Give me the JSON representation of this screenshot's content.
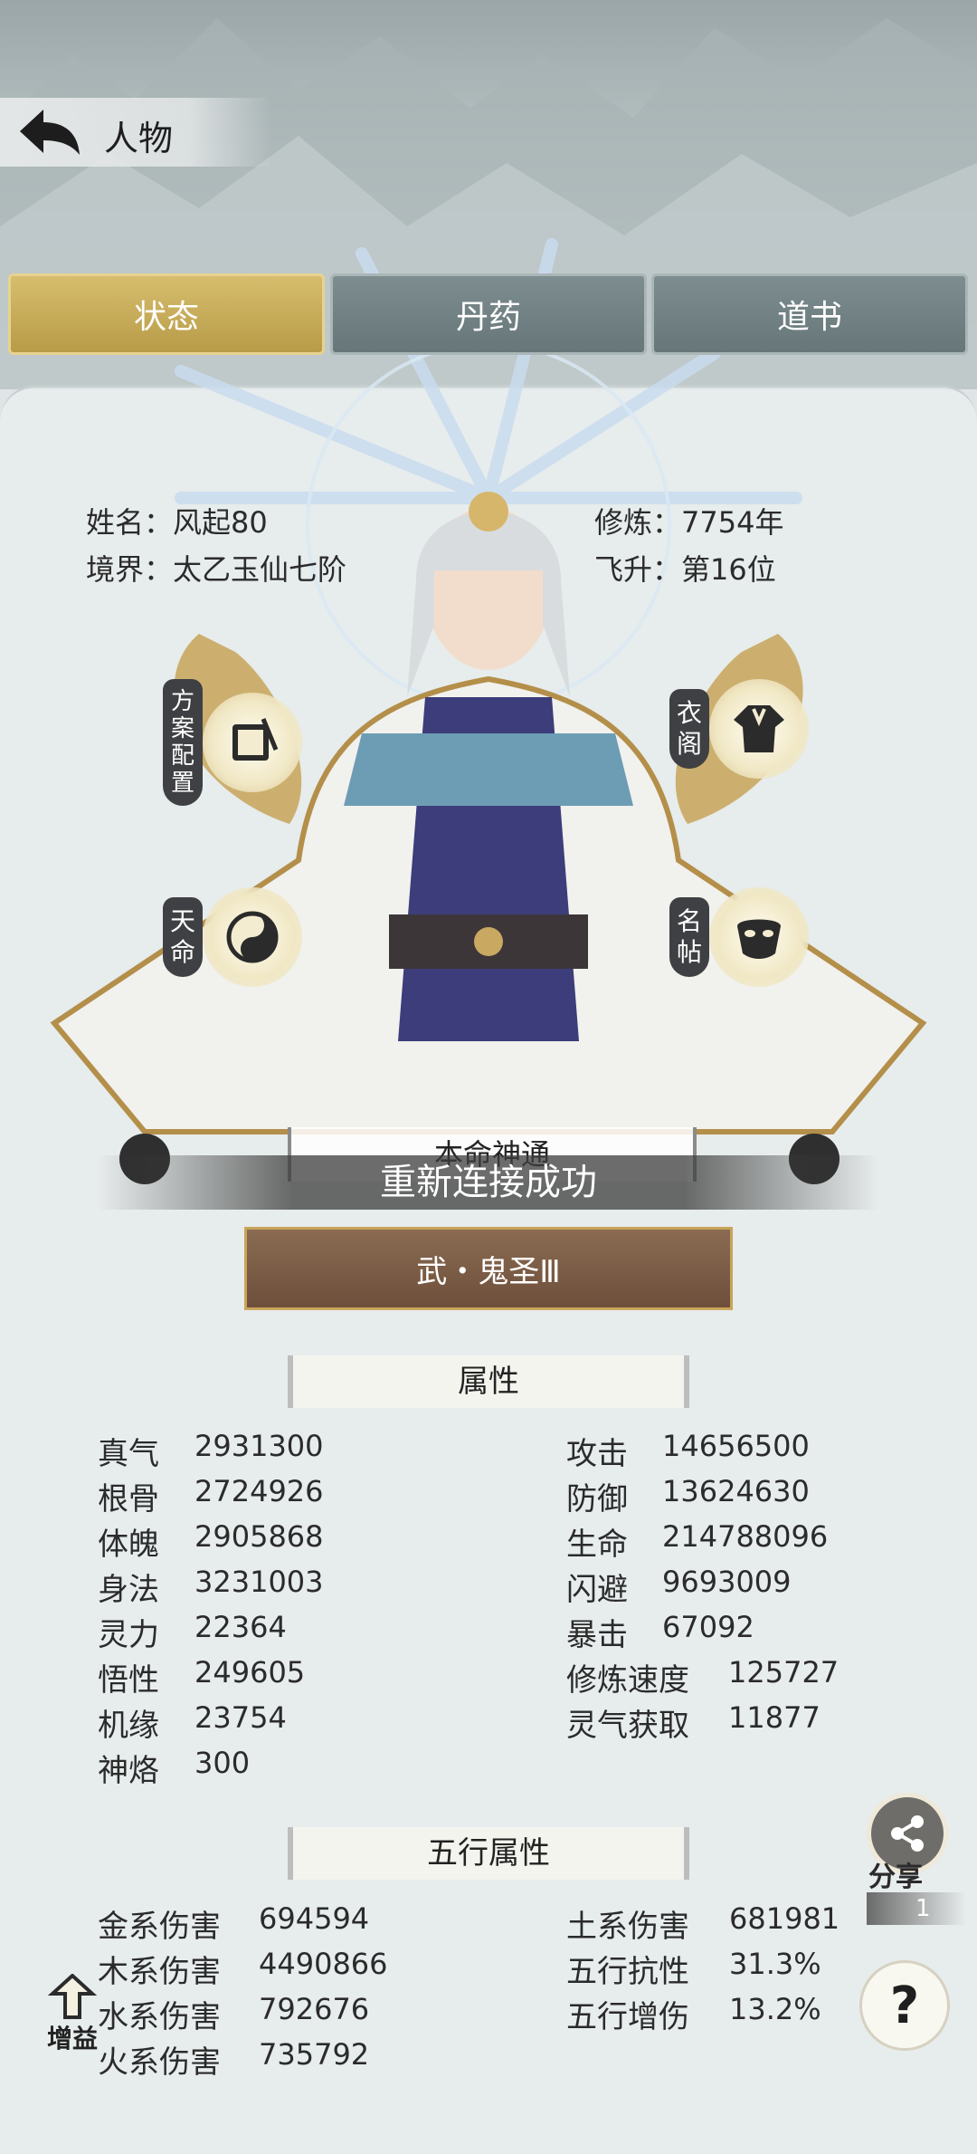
{
  "header": {
    "title": "人物"
  },
  "tabs": [
    {
      "label": "状态",
      "active": true
    },
    {
      "label": "丹药",
      "active": false
    },
    {
      "label": "道书",
      "active": false
    }
  ],
  "profile": {
    "name": "姓名：风起80",
    "realm": "境界：太乙玉仙七阶",
    "cultivation": "修炼：7754年",
    "ascension": "飞升：第16位"
  },
  "side_buttons": {
    "loadout": "方案配置",
    "wardrobe": "衣阁",
    "destiny": "天命",
    "card": "名帖"
  },
  "skill": {
    "label": "本命神通",
    "name": "武・鬼圣Ⅲ"
  },
  "toast": "重新连接成功",
  "attributes": {
    "title": "属性",
    "left": [
      {
        "label": "真气",
        "value": "2931300"
      },
      {
        "label": "根骨",
        "value": "2724926"
      },
      {
        "label": "体魄",
        "value": "2905868"
      },
      {
        "label": "身法",
        "value": "3231003"
      },
      {
        "label": "灵力",
        "value": "22364"
      },
      {
        "label": "悟性",
        "value": "249605"
      },
      {
        "label": "机缘",
        "value": "23754"
      },
      {
        "label": "神烙",
        "value": "300"
      }
    ],
    "right": [
      {
        "label": "攻击",
        "value": "14656500"
      },
      {
        "label": "防御",
        "value": "13624630"
      },
      {
        "label": "生命",
        "value": "214788096"
      },
      {
        "label": "闪避",
        "value": "9693009"
      },
      {
        "label": "暴击",
        "value": "67092"
      },
      {
        "label": "修炼速度",
        "value": "125727"
      },
      {
        "label": "灵气获取",
        "value": "11877"
      }
    ]
  },
  "elements": {
    "title": "五行属性",
    "left": [
      {
        "label": "金系伤害",
        "value": "694594"
      },
      {
        "label": "木系伤害",
        "value": "4490866"
      },
      {
        "label": "水系伤害",
        "value": "792676"
      },
      {
        "label": "火系伤害",
        "value": "735792"
      }
    ],
    "right": [
      {
        "label": "土系伤害",
        "value": "681981"
      },
      {
        "label": "五行抗性",
        "value": "31.3%"
      },
      {
        "label": "五行增伤",
        "value": "13.2%"
      }
    ]
  },
  "floating": {
    "share": "分享",
    "counter": "1",
    "help": "?",
    "buff": "增益"
  },
  "colors": {
    "tab_active": "#c9ad5a",
    "tab_idle": "#728285",
    "skill_button": "#7c5d47"
  },
  "icons": [
    "back-arrow-icon",
    "share-icon",
    "scroll-icon",
    "robe-icon",
    "yin-yang-icon",
    "mask-icon",
    "help-icon",
    "buff-arrow-icon"
  ]
}
